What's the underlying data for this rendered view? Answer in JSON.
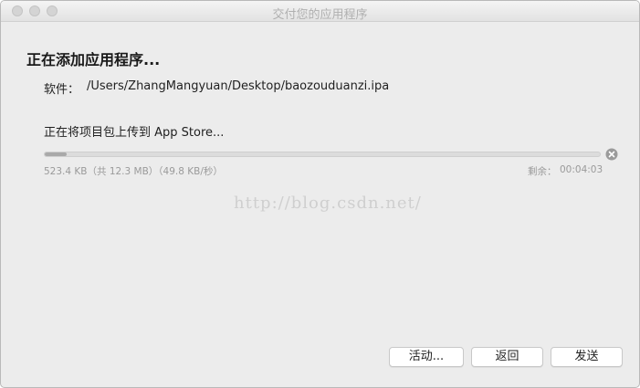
{
  "window": {
    "title": "交付您的应用程序"
  },
  "main": {
    "heading": "正在添加应用程序...",
    "software_label": "软件：",
    "software_path": "/Users/ZhangMangyuan/Desktop/baozouduanzi.ipa",
    "status_text": "正在将项目包上传到 App Store...",
    "progress": {
      "fraction": 0.04,
      "detail": "523.4 KB（共 12.3 MB）（49.8 KB/秒）",
      "remaining_label": "剩余：",
      "remaining_time": "00:04:03"
    },
    "watermark": "http://blog.csdn.net/"
  },
  "buttons": {
    "activity": "活动...",
    "back": "返回",
    "send": "发送"
  },
  "icons": {
    "cancel": "cancel-circle-icon"
  },
  "colors": {
    "window_bg": "#ececec",
    "progress_fill": "#a9a9a9",
    "muted_text": "#9a9a9a"
  }
}
